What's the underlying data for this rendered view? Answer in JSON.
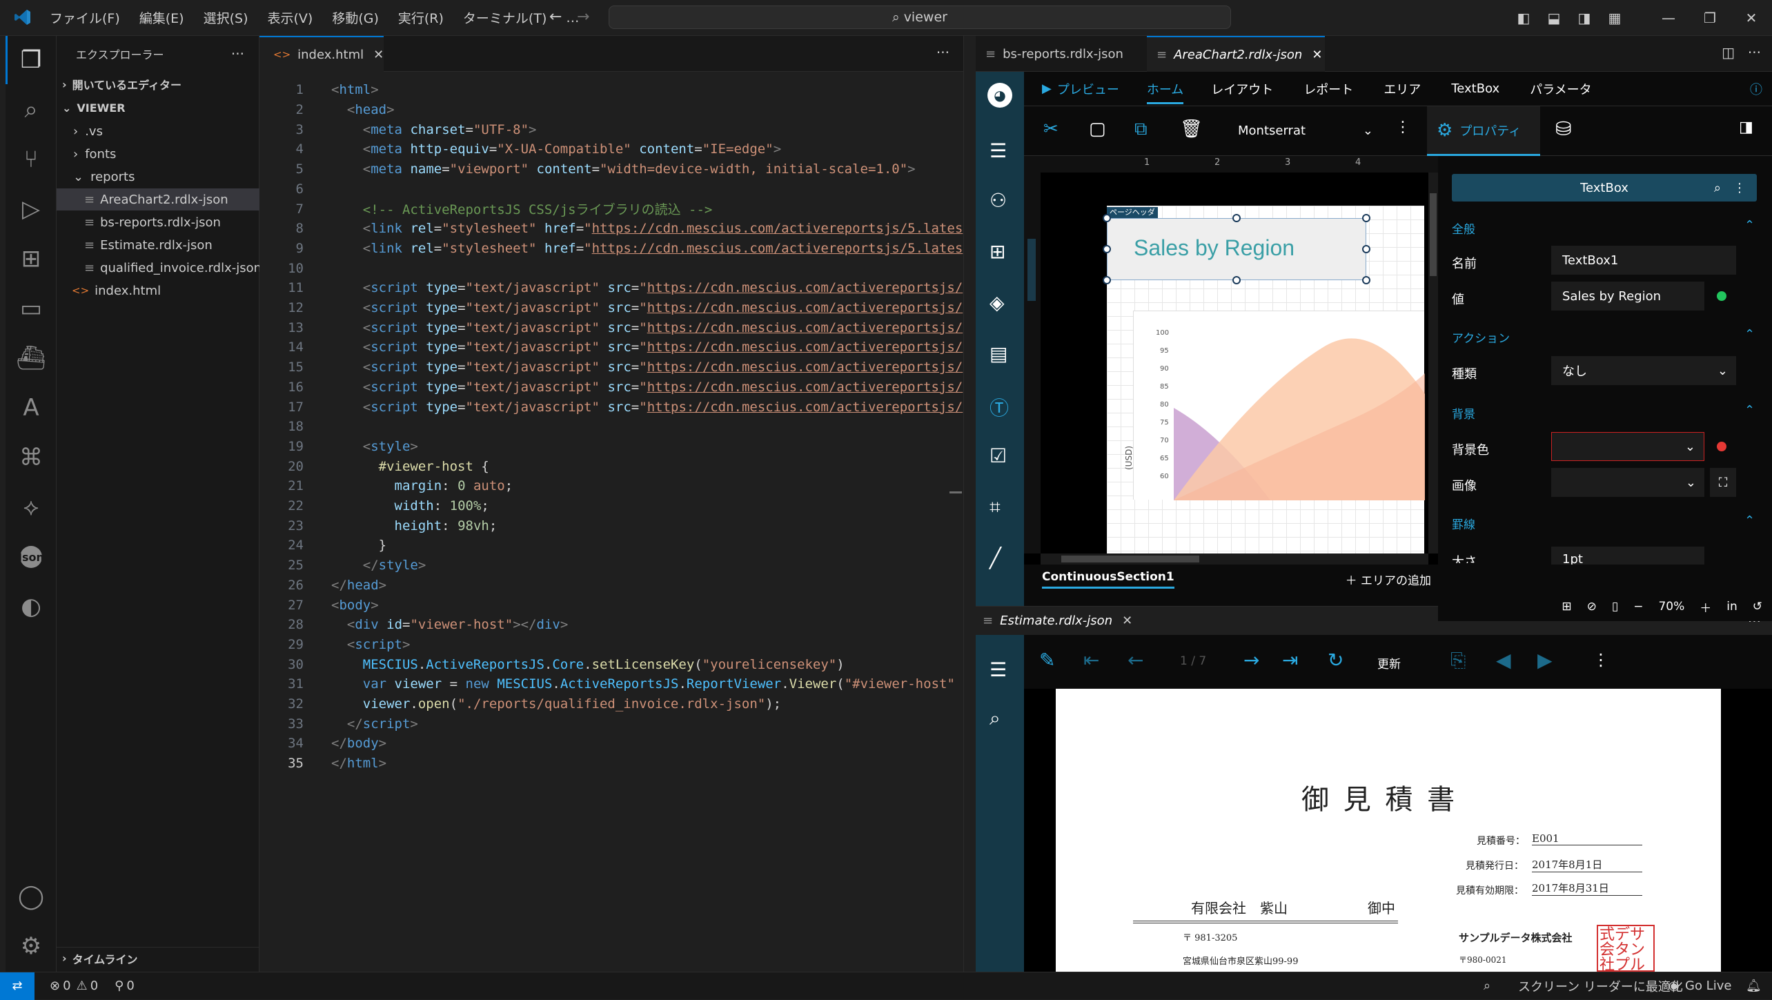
{
  "titlebar": {
    "menus": [
      "ファイル(F)",
      "編集(E)",
      "選択(S)",
      "表示(V)",
      "移動(G)",
      "実行(R)",
      "ターミナル(T)",
      "…"
    ],
    "search": "viewer"
  },
  "sidebar": {
    "title": "エクスプローラー",
    "open_editors": "開いているエディター",
    "root": "VIEWER",
    "items": [
      ".vs",
      "fonts",
      "reports",
      "AreaChart2.rdlx-json",
      "bs-reports.rdlx-json",
      "Estimate.rdlx-json",
      "qualified_invoice.rdlx-json",
      "index.html"
    ],
    "timeline": "タイムライン"
  },
  "editor": {
    "tab": "index.html",
    "current_line": 35
  },
  "designer": {
    "tabs": [
      "bs-reports.rdlx-json",
      "AreaChart2.rdlx-json"
    ],
    "menu": [
      "プレビュー",
      "ホーム",
      "レイアウト",
      "レポート",
      "エリア",
      "TextBox",
      "パラメータ"
    ],
    "font": "Montserrat",
    "props_label": "プロパティ",
    "page_header": "ページヘッダ",
    "title_text": "Sales by Region",
    "axis_label": "(USD)",
    "ticks": [
      "100",
      "95",
      "90",
      "85",
      "80",
      "75",
      "70",
      "65",
      "60"
    ],
    "ruler": [
      "1",
      "2",
      "3",
      "4"
    ],
    "section": "ContinuousSection1",
    "add_area": "エリアの追加",
    "zoom": "70%",
    "unit": "in",
    "props": {
      "selector": "TextBox",
      "general": "全般",
      "name_label": "名前",
      "name_value": "TextBox1",
      "value_label": "値",
      "value_value": "Sales by Region",
      "action": "アクション",
      "kind_label": "種類",
      "kind_value": "なし",
      "background": "背景",
      "bgcolor_label": "背景色",
      "image_label": "画像",
      "border": "罫線",
      "size_label": "大さ",
      "size_value": "1pt"
    }
  },
  "viewer": {
    "tab": "Estimate.rdlx-json",
    "page": "1 / 7",
    "refresh": "更新",
    "doc": {
      "title": "御 見 積 書",
      "no_label": "見積番号：",
      "no_value": "E001",
      "issue_label": "見積発行日：",
      "issue_value": "2017年8月1日",
      "valid_label": "見積有効期限：",
      "valid_value": "2017年8月31日",
      "client": "有限会社　紫山",
      "honorific": "御中",
      "postal": "〒 981-3205",
      "address": "宮城県仙台市泉区紫山99-99",
      "company": "サンプルデータ株式会社",
      "company_postal": "〒980-0021",
      "stamp": "式デサ会タン社プル"
    }
  },
  "status": {
    "errors": "0",
    "warnings": "0",
    "ports": "0",
    "screenreader": "スクリーン リーダーに最適化",
    "golive": "Go Live"
  }
}
